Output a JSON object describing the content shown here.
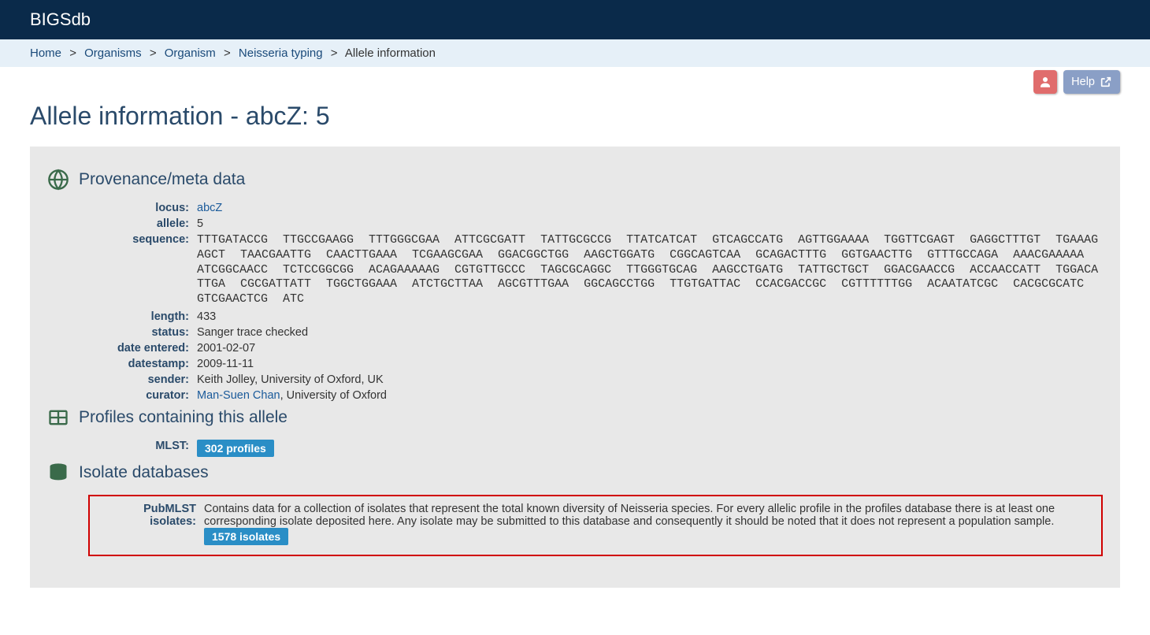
{
  "app_title": "BIGSdb",
  "breadcrumb": {
    "items": [
      {
        "label": "Home",
        "link": true
      },
      {
        "label": "Organisms",
        "link": true
      },
      {
        "label": "Organism",
        "link": true
      },
      {
        "label": "Neisseria typing",
        "link": true
      },
      {
        "label": "Allele information",
        "link": false
      }
    ]
  },
  "help_label": "Help",
  "page_title": "Allele information - abcZ: 5",
  "sections": {
    "provenance": {
      "heading": "Provenance/meta data",
      "fields": {
        "locus_label": "locus:",
        "locus_value": "abcZ",
        "allele_label": "allele:",
        "allele_value": "5",
        "sequence_label": "sequence:",
        "sequence_value": "TTTGATACCG TTGCCGAAGG TTTGGGCGAA ATTCGCGATT TATTGCGCCG TTATCATCAT GTCAGCCATG AGTTGGAAAA TGGTTCGAGT GAGGCTTTGT TGAAAGAGCT TAACGAATTG CAACTTGAAA TCGAAGCGAA GGACGGCTGG AAGCTGGATG CGGCAGTCAA GCAGACTTTG GGTGAACTTG GTTTGCCAGA AAACGAAAAA ATCGGCAACC TCTCCGGCGG ACAGAAAAAG CGTGTTGCCC TAGCGCAGGC TTGGGTGCAG AAGCCTGATG TATTGCTGCT GGACGAACCG ACCAACCATT TGGACATTGA CGCGATTATT TGGCTGGAAA ATCTGCTTAA AGCGTTTGAA GGCAGCCTGG TTGTGATTAC CCACGACCGC CGTTTTTTGG ACAATATCGC CACGCGCATC GTCGAACTCG ATC",
        "length_label": "length:",
        "length_value": "433",
        "status_label": "status:",
        "status_value": "Sanger trace checked",
        "date_entered_label": "date entered:",
        "date_entered_value": "2001-02-07",
        "datestamp_label": "datestamp:",
        "datestamp_value": "2009-11-11",
        "sender_label": "sender:",
        "sender_value": "Keith Jolley, University of Oxford, UK",
        "curator_label": "curator:",
        "curator_link": "Man-Suen Chan",
        "curator_suffix": ", University of Oxford"
      }
    },
    "profiles": {
      "heading": "Profiles containing this allele",
      "mlst_label": "MLST:",
      "mlst_badge": "302 profiles"
    },
    "isolates": {
      "heading": "Isolate databases",
      "label": "PubMLST isolates:",
      "description": "Contains data for a collection of isolates that represent the total known diversity of Neisseria species. For every allelic profile in the profiles database there is at least one corresponding isolate deposited here. Any isolate may be submitted to this database and consequently it should be noted that it does not represent a population sample. ",
      "badge": "1578 isolates"
    }
  }
}
